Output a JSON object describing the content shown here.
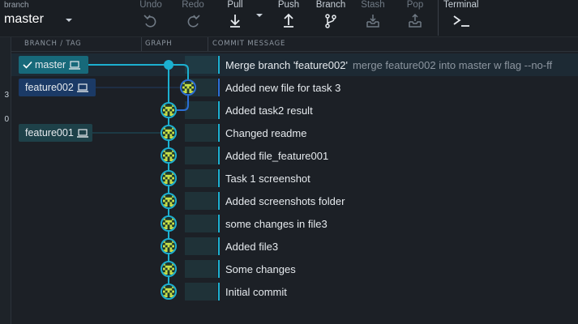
{
  "toolbar": {
    "branch_caption": "branch",
    "branch_name": "master",
    "undo": "Undo",
    "redo": "Redo",
    "pull": "Pull",
    "push": "Push",
    "branch": "Branch",
    "stash": "Stash",
    "pop": "Pop",
    "terminal": "Terminal"
  },
  "left_strip": {
    "chars": [
      "3",
      "0"
    ]
  },
  "columns": {
    "branch_tag": "BRANCH / TAG",
    "graph": "GRAPH",
    "commit_message": "COMMIT MESSAGE"
  },
  "refs": {
    "master": "master",
    "feature002": "feature002",
    "feature001": "feature001"
  },
  "commits": [
    {
      "message": "Merge branch 'feature002'",
      "description": "merge feature002 into master w flag --no-ff"
    },
    {
      "message": "Added new file for task 3"
    },
    {
      "message": "Added task2 result"
    },
    {
      "message": "Changed readme"
    },
    {
      "message": "Added file_feature001"
    },
    {
      "message": "Task 1 screenshot"
    },
    {
      "message": "Added screenshots folder"
    },
    {
      "message": "some changes in file3"
    },
    {
      "message": "Added file3"
    },
    {
      "message": "Some changes"
    },
    {
      "message": "Initial commit"
    }
  ],
  "colors": {
    "background": "#1c2026",
    "master_lane": "#1cb0d0",
    "feature002_lane": "#2b6fd6",
    "avatar_pattern": "#c8e04a"
  },
  "icons": [
    "undo-icon",
    "redo-icon",
    "pull-icon",
    "push-icon",
    "branch-icon",
    "stash-icon",
    "pop-icon",
    "terminal-icon",
    "check-icon",
    "laptop-icon",
    "identicon-avatar"
  ]
}
